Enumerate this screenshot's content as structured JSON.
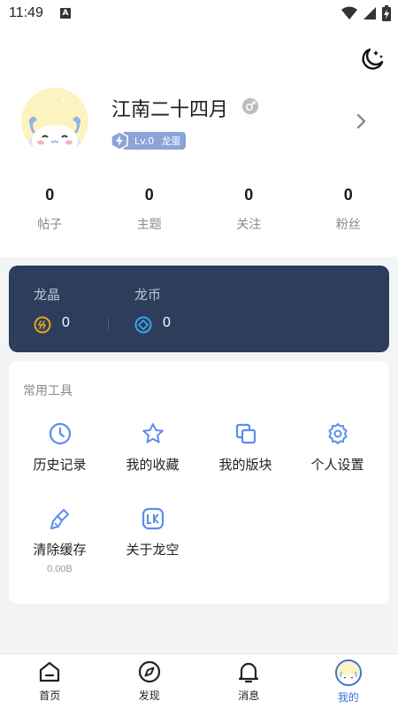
{
  "status_bar": {
    "time": "11:49",
    "notification_letter": "A"
  },
  "profile": {
    "username": "江南二十四月",
    "level": "Lv.0",
    "level_title": "龙蛋"
  },
  "stats": [
    {
      "value": "0",
      "label": "帖子"
    },
    {
      "value": "0",
      "label": "主题"
    },
    {
      "value": "0",
      "label": "关注"
    },
    {
      "value": "0",
      "label": "粉丝"
    }
  ],
  "wallet": {
    "crystal_label": "龙晶",
    "crystal_value": "0",
    "coin_label": "龙币",
    "coin_value": "0"
  },
  "tools": {
    "title": "常用工具",
    "items": [
      {
        "label": "历史记录",
        "icon": "clock-icon"
      },
      {
        "label": "我的收藏",
        "icon": "star-icon"
      },
      {
        "label": "我的版块",
        "icon": "copy-icon"
      },
      {
        "label": "个人设置",
        "icon": "gear-icon"
      },
      {
        "label": "清除缓存",
        "sub": "0.00B",
        "icon": "broom-icon"
      },
      {
        "label": "关于龙空",
        "icon": "lk-logo-icon"
      }
    ]
  },
  "tabbar": {
    "items": [
      {
        "label": "首页",
        "icon": "home-icon"
      },
      {
        "label": "发现",
        "icon": "compass-icon"
      },
      {
        "label": "消息",
        "icon": "bell-icon"
      },
      {
        "label": "我的",
        "icon": "avatar",
        "active": true
      }
    ]
  },
  "colors": {
    "accent": "#3b6fe0",
    "wallet_bg": "#2c3e5c",
    "icon_blue": "#5b8def",
    "crystal": "#e8a317",
    "coin": "#3ba3e8"
  }
}
